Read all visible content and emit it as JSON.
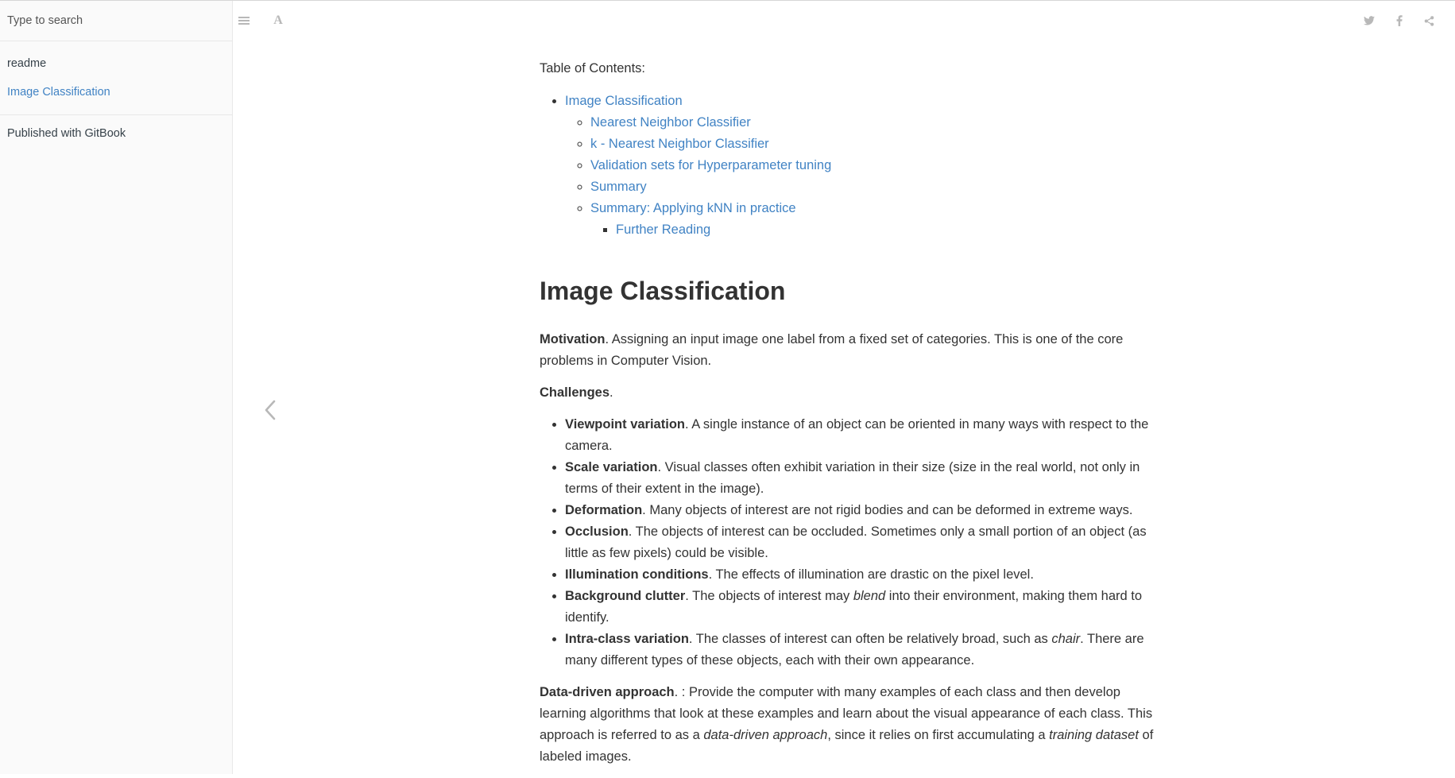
{
  "search": {
    "placeholder": "Type to search"
  },
  "sidebar": {
    "items": [
      {
        "label": "readme",
        "active": false
      },
      {
        "label": "Image Classification",
        "active": true
      }
    ],
    "footer": "Published with GitBook"
  },
  "header": {
    "icons": [
      "menu-icon",
      "font-settings-icon",
      "twitter-icon",
      "facebook-icon",
      "share-icon"
    ],
    "font_button": "A"
  },
  "colors": {
    "link": "#4183c4",
    "text": "#333333",
    "sidebar_bg": "#fafafa",
    "icon": "#b8b8b8"
  },
  "content": {
    "toc_label": "Table of Contents:",
    "toc": {
      "title": "Image Classification",
      "items": [
        "Nearest Neighbor Classifier",
        "k - Nearest Neighbor Classifier",
        "Validation sets for Hyperparameter tuning",
        "Summary",
        "Summary: Applying kNN in practice"
      ],
      "sub_item": "Further Reading"
    },
    "heading": "Image Classification",
    "motivation": {
      "term": "Motivation",
      "text": ". Assigning an input image one label from a fixed set of categories. This is one of the core problems in Computer Vision."
    },
    "challenges_term": "Challenges",
    "challenges_period": ".",
    "challenges": [
      {
        "term": "Viewpoint variation",
        "text": ". A single instance of an object can be oriented in many ways with respect to the camera."
      },
      {
        "term": "Scale variation",
        "text": ". Visual classes often exhibit variation in their size (size in the real world, not only in terms of their extent in the image)."
      },
      {
        "term": "Deformation",
        "text": ". Many objects of interest are not rigid bodies and can be deformed in extreme ways."
      },
      {
        "term": "Occlusion",
        "text": ". The objects of interest can be occluded. Sometimes only a small portion of an object (as little as few pixels) could be visible."
      },
      {
        "term": "Illumination conditions",
        "text": ". The effects of illumination are drastic on the pixel level."
      },
      {
        "term": "Background clutter",
        "text_before": ". The objects of interest may ",
        "emph": "blend",
        "text_after": " into their environment, making them hard to identify."
      },
      {
        "term": "Intra-class variation",
        "text_before": ". The classes of interest can often be relatively broad, such as ",
        "emph": "chair",
        "text_after": ". There are many different types of these objects, each with their own appearance."
      }
    ],
    "data_driven": {
      "term": "Data-driven approach",
      "text1": ". : Provide the computer with many examples of each class and then develop learning algorithms that look at these examples and learn about the visual appearance of each class. This approach is referred to as a ",
      "emph1": "data-driven approach",
      "text2": ", since it relies on first accumulating a ",
      "emph2": "training dataset",
      "text3": " of labeled images."
    }
  }
}
